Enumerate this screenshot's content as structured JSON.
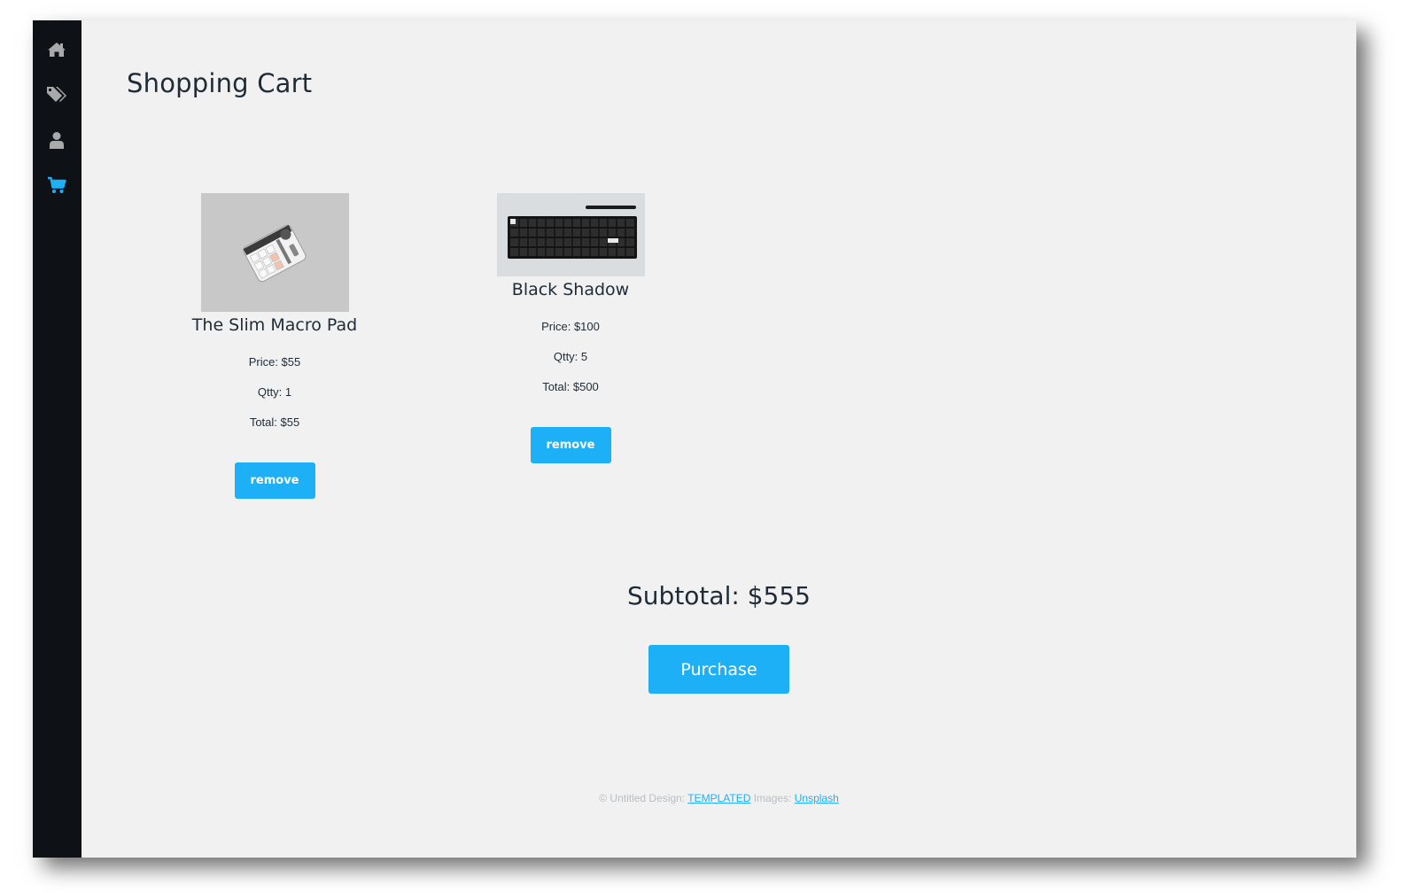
{
  "sidebar": {
    "items": [
      {
        "icon": "home-icon",
        "active": false
      },
      {
        "icon": "tags-icon",
        "active": false
      },
      {
        "icon": "user-icon",
        "active": false
      },
      {
        "icon": "shopping-cart-icon",
        "active": true
      }
    ],
    "colors": {
      "inactive": "#a7a9ab",
      "active": "#1eb0f6"
    }
  },
  "page": {
    "title": "Shopping Cart"
  },
  "cart": {
    "items": [
      {
        "name": "The Slim Macro Pad",
        "price": "Price: $55",
        "qty": "Qtty: 1",
        "total": "Total: $55",
        "remove_label": "remove",
        "image": "macro-pad-photo"
      },
      {
        "name": "Black Shadow",
        "price": "Price: $100",
        "qty": "Qtty: 5",
        "total": "Total: $500",
        "remove_label": "remove",
        "image": "keyboard-photo"
      }
    ],
    "subtotal": "Subtotal: $555",
    "purchase_label": "Purchase"
  },
  "footer": {
    "prefix": "© Untitled Design: ",
    "templated_link": "TEMPLATED",
    "images_label": " Images: ",
    "unsplash_link": "Unsplash"
  },
  "colors": {
    "accent": "#1eb0f6",
    "sidebar_bg": "#0e1216",
    "content_bg": "#f1f1f1",
    "text": "#1f2b36"
  }
}
